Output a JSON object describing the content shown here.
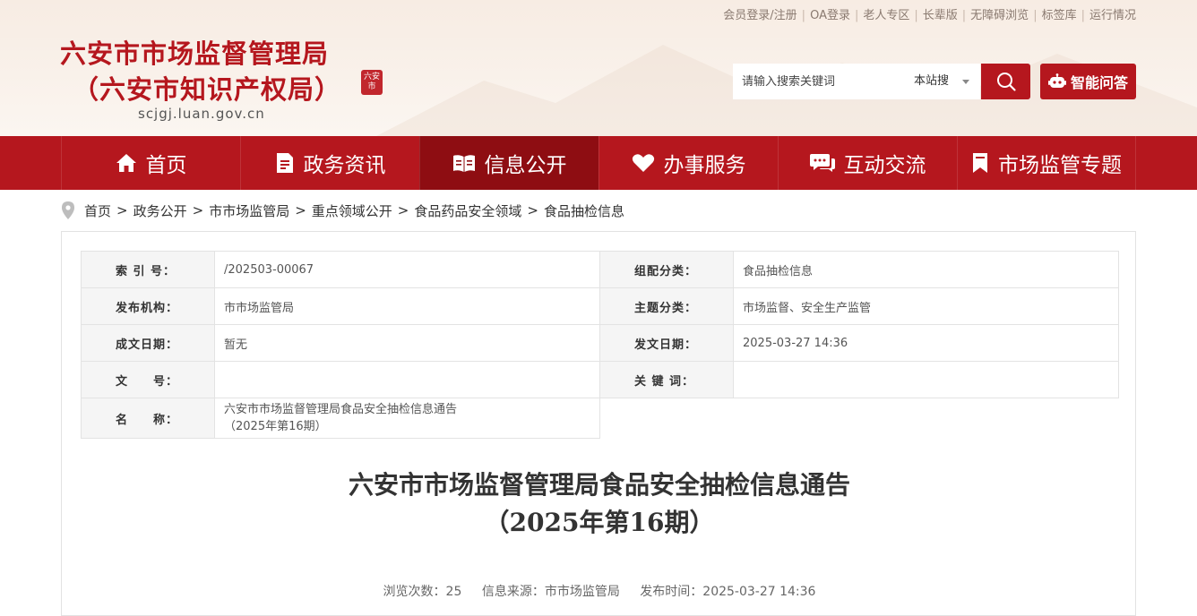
{
  "top_links": [
    {
      "label": "会员登录/注册"
    },
    {
      "label": "OA登录"
    },
    {
      "label": "老人专区"
    },
    {
      "label": "长辈版"
    },
    {
      "label": "无障碍浏览"
    },
    {
      "label": "标签库"
    },
    {
      "label": "运行情况"
    }
  ],
  "site": {
    "title_line1": "六安市市场监督管理局",
    "title_line2": "（六安市知识产权局）",
    "domain": "scjgj.luan.gov.cn",
    "seal_text": "六安市"
  },
  "search": {
    "placeholder": "请输入搜索关键词",
    "scope": "本站搜",
    "icon": "search-icon"
  },
  "ai_button": {
    "label": "智能问答",
    "icon": "robot-icon"
  },
  "colors": {
    "brand_red": "#b5171e",
    "nav_active": "#8e0d12",
    "header_bg": "#f7ece3"
  },
  "nav": [
    {
      "label": "首页",
      "icon": "home-icon"
    },
    {
      "label": "政务资讯",
      "icon": "document-icon"
    },
    {
      "label": "信息公开",
      "icon": "open-book-icon"
    },
    {
      "label": "办事服务",
      "icon": "heart-icon"
    },
    {
      "label": "互动交流",
      "icon": "chat-icon"
    },
    {
      "label": "市场监管专题",
      "icon": "bookmark-icon"
    }
  ],
  "nav_active_index": 2,
  "breadcrumb": [
    "首页",
    "政务公开",
    "市市场监管局",
    "重点领域公开",
    "食品药品安全领域",
    "食品抽检信息"
  ],
  "breadcrumb_sep": ">",
  "meta": {
    "index_label": "索 引 号：",
    "index_value": "/202503-00067",
    "category_label": "组配分类：",
    "category_value": "食品抽检信息",
    "publisher_label": "发布机构：",
    "publisher_value": "市市场监管局",
    "topic_label": "主题分类：",
    "topic_value": "市场监督、安全生产监管",
    "created_label": "成文日期：",
    "created_value": "暂无",
    "issued_label": "发文日期：",
    "issued_value": "2025-03-27 14:36",
    "docno_label": "文　　号：",
    "docno_value": "",
    "keywords_label": "关 键 词：",
    "keywords_value": "",
    "name_label": "名　　称：",
    "name_value_line1": "六安市市场监督管理局食品安全抽检信息通告",
    "name_value_line2": "（2025年第16期）"
  },
  "article": {
    "title_line1": "六安市市场监督管理局食品安全抽检信息通告",
    "title_line2": "（2025年第16期）",
    "views": "浏览次数：25",
    "source": "信息来源：市市场监管局",
    "published": "发布时间：2025-03-27 14:36"
  }
}
